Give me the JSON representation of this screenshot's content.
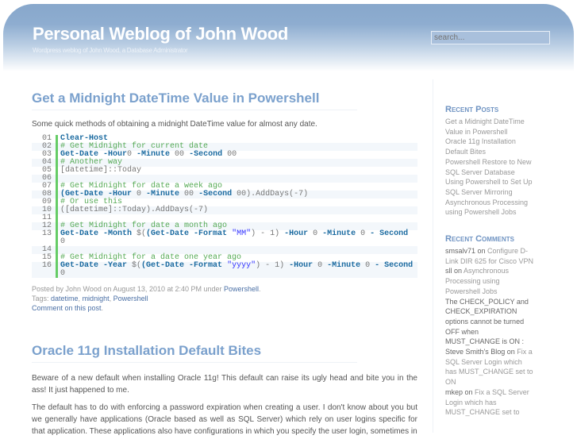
{
  "header": {
    "title": "Personal Weblog of John Wood",
    "tagline": "Wordpress weblog of John Wood, a Database Administrator",
    "search_placeholder": "search..."
  },
  "posts": [
    {
      "title": "Get a Midnight DateTime Value in Powershell",
      "intro": "Some quick methods of obtaining a midnight DateTime value for almost any date.",
      "code": [
        [
          "01",
          [
            [
              "k",
              "Clear-Host"
            ]
          ]
        ],
        [
          "02",
          [
            [
              "c",
              "# Get Midnight for current date"
            ]
          ]
        ],
        [
          "03",
          [
            [
              "k",
              "Get-Date -Hour"
            ],
            [
              "",
              "0 "
            ],
            [
              "k",
              "-Minute"
            ],
            [
              "",
              " 00 "
            ],
            [
              "k",
              "-Second"
            ],
            [
              "",
              " 00"
            ]
          ]
        ],
        [
          "04",
          [
            [
              "c",
              "# Another way"
            ]
          ]
        ],
        [
          "05",
          [
            [
              "",
              "[datetime]::Today"
            ]
          ]
        ],
        [
          "06",
          [
            [
              "",
              ""
            ]
          ]
        ],
        [
          "07",
          [
            [
              "c",
              "# Get Midnight for date a week ago"
            ]
          ]
        ],
        [
          "08",
          [
            [
              "k",
              "(Get-Date -Hour"
            ],
            [
              "",
              " 0 "
            ],
            [
              "k",
              "-Minute"
            ],
            [
              "",
              " 00 "
            ],
            [
              "k",
              "-Second"
            ],
            [
              "",
              " 00).AddDays(-7)"
            ]
          ]
        ],
        [
          "09",
          [
            [
              "c",
              "# Or use this"
            ]
          ]
        ],
        [
          "10",
          [
            [
              "",
              "([datetime]::Today).AddDays(-7)"
            ]
          ]
        ],
        [
          "11",
          [
            [
              "",
              ""
            ]
          ]
        ],
        [
          "12",
          [
            [
              "c",
              "# Get Midnight for date a month ago"
            ]
          ]
        ],
        [
          "13",
          [
            [
              "k",
              "Get-Date -Month"
            ],
            [
              "",
              " $("
            ],
            [
              "k",
              "(Get-Date -Format"
            ],
            [
              "",
              " "
            ],
            [
              "s",
              "\"MM\""
            ],
            [
              "",
              ") - 1) "
            ],
            [
              "k",
              "-Hour"
            ],
            [
              "",
              " 0 "
            ],
            [
              "k",
              "-Minute"
            ],
            [
              "",
              " 0 "
            ],
            [
              "k",
              "- Second"
            ],
            [
              "",
              " 0"
            ]
          ]
        ],
        [
          "14",
          [
            [
              "",
              ""
            ]
          ]
        ],
        [
          "15",
          [
            [
              "c",
              "# Get Midnight for a date one year ago"
            ]
          ]
        ],
        [
          "16",
          [
            [
              "k",
              "Get-Date -Year"
            ],
            [
              "",
              " $("
            ],
            [
              "k",
              "(Get-Date -Format"
            ],
            [
              "",
              " "
            ],
            [
              "s",
              "\"yyyy\""
            ],
            [
              "",
              ") - 1) "
            ],
            [
              "k",
              "-Hour"
            ],
            [
              "",
              " 0 "
            ],
            [
              "k",
              "-Minute"
            ],
            [
              "",
              " 0 "
            ],
            [
              "k",
              "- Second"
            ],
            [
              "",
              " 0"
            ]
          ]
        ]
      ],
      "meta": {
        "posted": "Posted by John Wood on August 13, 2010 at 2:40 PM under ",
        "category": "Powershell",
        "tags_label": "Tags: ",
        "tags": [
          "datetime",
          "midnight",
          "Powershell"
        ],
        "comment": "Comment on this post"
      }
    },
    {
      "title": "Oracle 11g Installation Default Bites",
      "paragraphs": [
        "Beware of a new default when installing Oracle 11g! This default can raise its ugly head and bite you in the ass! It just happened to me.",
        "The default has to do with enforcing a password expiration when creating a user. I don't know about you but we generally have applications (Oracle based as well as SQL Server) which rely on user logins specific for that application. These applications also have configurations in which you specify the user login, sometimes in"
      ]
    }
  ],
  "sidebar": {
    "recent_posts_title": "Recent Posts",
    "recent_posts": [
      "Get a Midnight DateTime Value in Powershell",
      "Oracle 11g Installation Default Bites",
      "Powershell Restore to New SQL Server Database",
      "Using Powershell to Set Up SQL Server Mirroring",
      "Asynchronous Processing using Powershell Jobs"
    ],
    "recent_comments_title": "Recent Comments",
    "recent_comments": [
      {
        "author": "smsalv71",
        "on": " on ",
        "post": "Configure D-Link DIR 625 for Cisco VPN"
      },
      {
        "author": "sll",
        "on": " on ",
        "post": "Asynchronous Processing using Powershell Jobs"
      },
      {
        "author": "The CHECK_POLICY and CHECK_EXPIRATION options cannot be turned OFF when MUST_CHANGE is ON : Steve Smith's Blog",
        "on": " on ",
        "post": "Fix a SQL Server Login which has MUST_CHANGE set to ON"
      },
      {
        "author": "mkep",
        "on": " on ",
        "post": "Fix a SQL Server Login which has MUST_CHANGE set to"
      }
    ]
  }
}
